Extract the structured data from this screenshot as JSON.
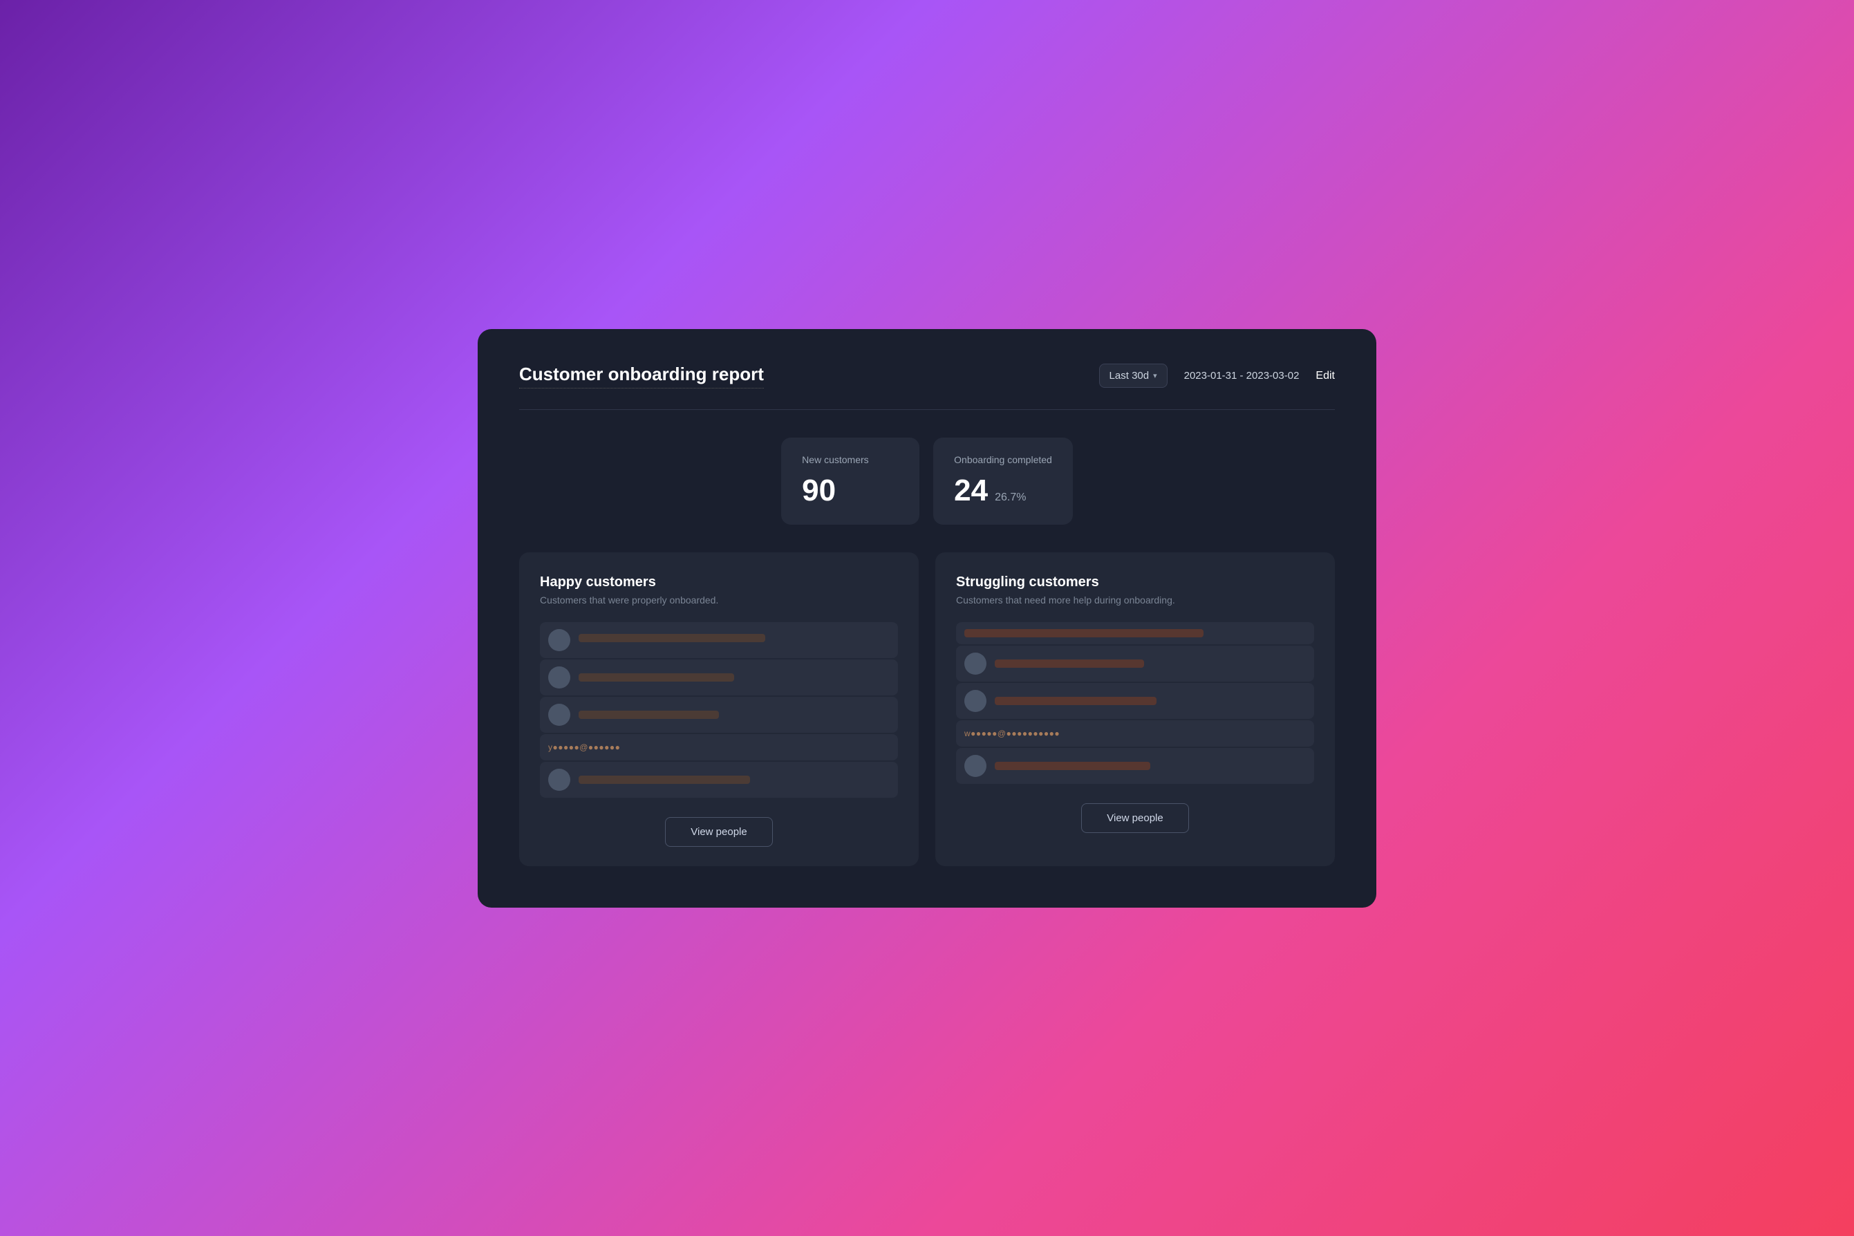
{
  "header": {
    "title": "Customer onboarding report",
    "date_range_label": "Last 30d",
    "date_range_value": "2023-01-31 - 2023-03-02",
    "edit_label": "Edit"
  },
  "metrics": {
    "new_customers_label": "New customers",
    "new_customers_value": "90",
    "onboarding_completed_label": "Onboarding completed",
    "onboarding_completed_value": "24",
    "onboarding_completed_sub": "26.7%"
  },
  "happy_customers": {
    "title": "Happy customers",
    "subtitle": "Customers that were properly onboarded.",
    "view_people_label": "View people"
  },
  "struggling_customers": {
    "title": "Struggling customers",
    "subtitle": "Customers that need more help during onboarding.",
    "view_people_label": "View people"
  }
}
